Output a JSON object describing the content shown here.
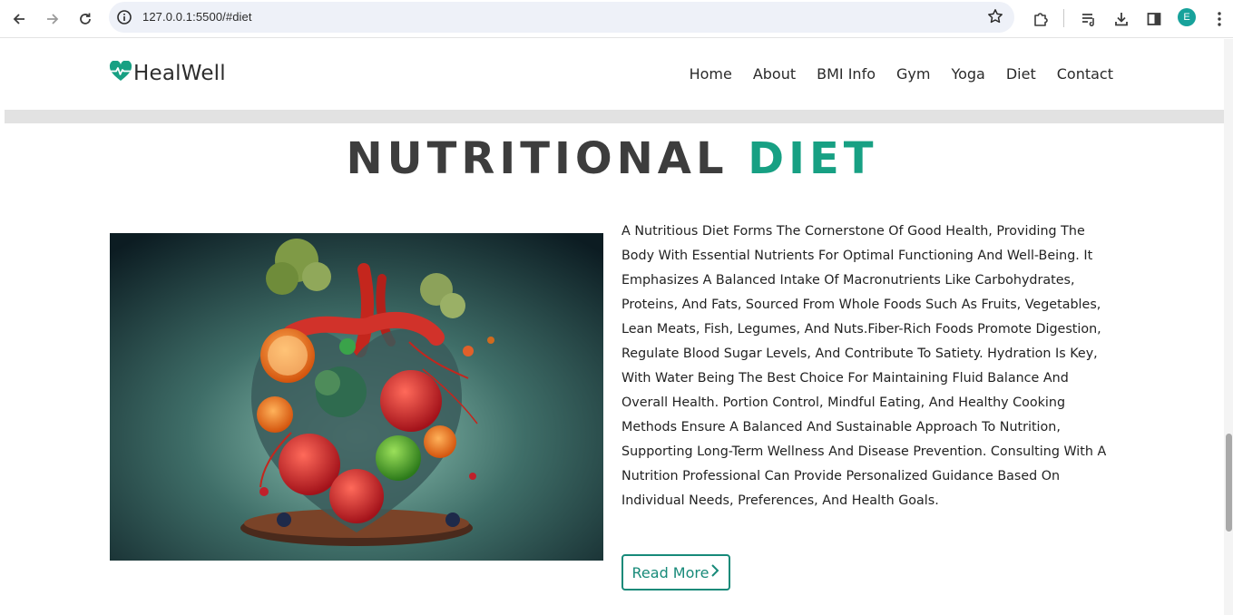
{
  "browser": {
    "url": "127.0.0.1:5500/#diet",
    "profile_initial": "E",
    "icons": [
      "back-icon",
      "forward-icon",
      "reload-icon",
      "site-info-icon",
      "bookmark-star-icon",
      "extensions-icon",
      "reading-list-icon",
      "download-icon",
      "side-panel-icon",
      "profile-avatar",
      "more-menu-icon"
    ]
  },
  "site": {
    "logo_text": "HealWell",
    "brand_color": "#17a083",
    "nav": [
      "Home",
      "About",
      "BMI Info",
      "Gym",
      "Yoga",
      "Diet",
      "Contact"
    ]
  },
  "section": {
    "title_part1": "NUTRITIONAL",
    "title_part2": "DIET",
    "paragraph": "A Nutritious Diet Forms The Cornerstone Of Good Health, Providing The Body With Essential Nutrients For Optimal Functioning And Well-Being. It Emphasizes A Balanced Intake Of Macronutrients Like Carbohydrates, Proteins, And Fats, Sourced From Whole Foods Such As Fruits, Vegetables, Lean Meats, Fish, Legumes, And Nuts.Fiber-Rich Foods Promote Digestion, Regulate Blood Sugar Levels, And Contribute To Satiety. Hydration Is Key, With Water Being The Best Choice For Maintaining Fluid Balance And Overall Health. Portion Control, Mindful Eating, And Healthy Cooking Methods Ensure A Balanced And Sustainable Approach To Nutrition, Supporting Long-Term Wellness And Disease Prevention. Consulting With A Nutrition Professional Can Provide Personalized Guidance Based On Individual Needs, Preferences, And Health Goals.",
    "button_label": "Read More"
  }
}
